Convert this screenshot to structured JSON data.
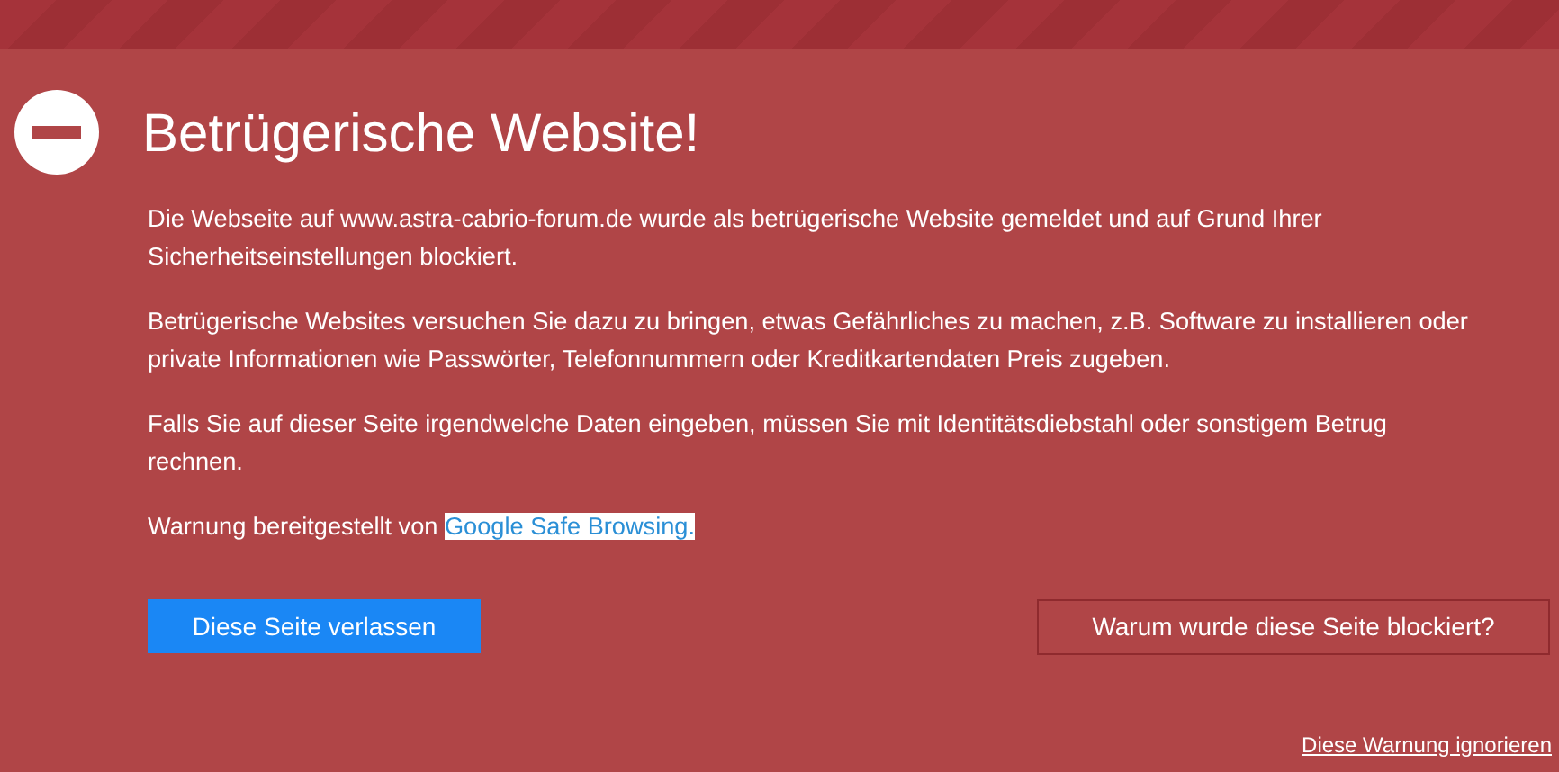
{
  "title": "Betrügerische Website!",
  "paragraphs": [
    {
      "text": "Die Webseite auf www.astra-cabrio-forum.de wurde als betrügerische Website gemeldet und auf Grund Ihrer Sicherheitseinstellungen blockiert."
    },
    {
      "text": "Betrügerische Websites versuchen Sie dazu zu bringen, etwas Gefährliches zu machen, z.B. Software zu installieren oder private Informationen wie Passwörter, Telefonnummern oder Kreditkartendaten Preis zugeben."
    },
    {
      "text": "Falls Sie auf dieser Seite irgendwelche Daten eingeben, müssen Sie mit Identitätsdiebstahl oder sonstigem Betrug rechnen."
    },
    {
      "text": "Warnung bereitgestellt von ",
      "link": {
        "text": "Google Safe Browsing.",
        "highlighted": true
      }
    }
  ],
  "buttons": [
    {
      "label": "Diese Seite verlassen",
      "kind": "primary"
    },
    {
      "label": "Warum wurde diese Seite blockiert?",
      "kind": "outline"
    }
  ],
  "ignore_link": "Diese Warnung ignorieren"
}
